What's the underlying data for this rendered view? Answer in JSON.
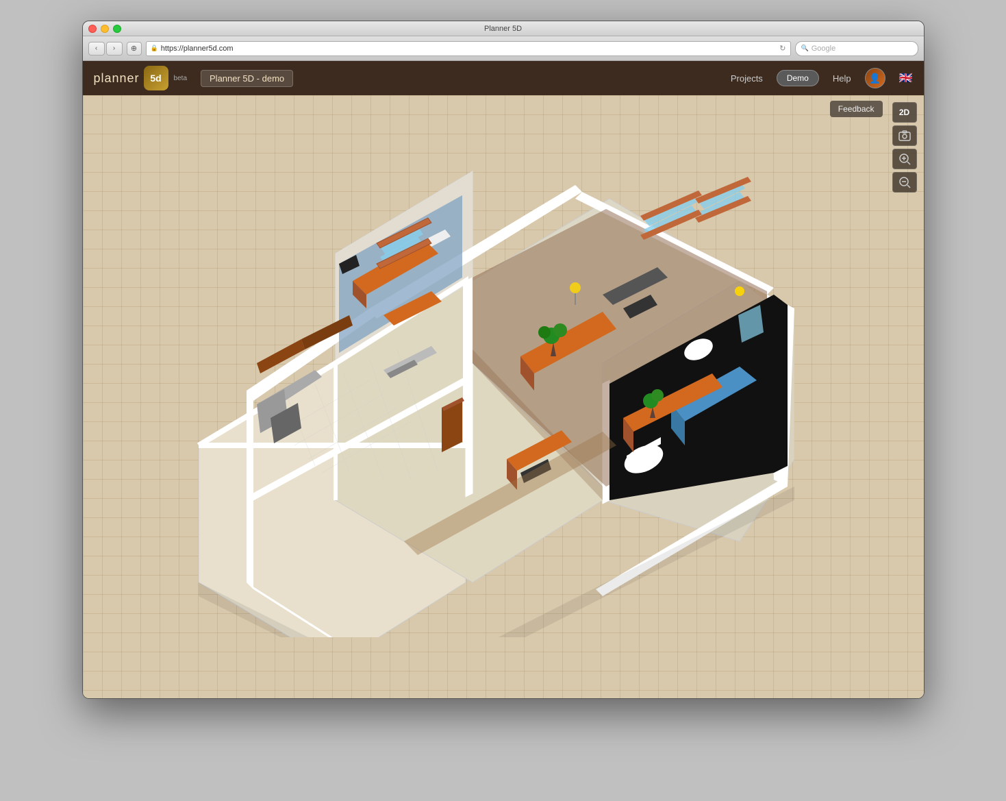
{
  "window": {
    "title": "Planner 5D"
  },
  "browser": {
    "url": "https://planner5d.com",
    "search_placeholder": "Google"
  },
  "header": {
    "logo_text": "planner",
    "logo_badge": "5d",
    "beta_label": "beta",
    "project_name": "Planner 5D - demo",
    "nav": {
      "projects": "Projects",
      "demo": "Demo",
      "help": "Help"
    }
  },
  "toolbar": {
    "feedback_label": "Feedback",
    "view_2d": "2D",
    "screenshot_icon": "📷",
    "zoom_in_icon": "🔍+",
    "zoom_out_icon": "🔍-"
  },
  "floorplan": {
    "description": "3D isometric floor plan with multiple rooms"
  }
}
